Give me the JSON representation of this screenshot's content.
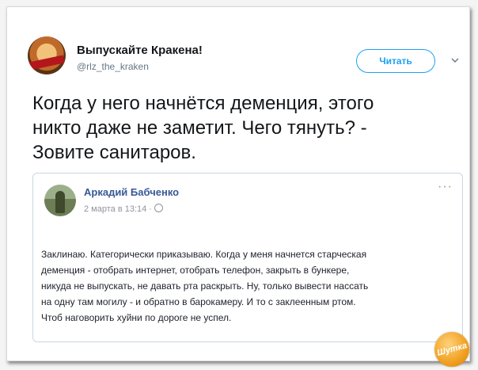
{
  "tweet": {
    "author_name": "Выпускайте Кракена!",
    "author_handle": "@rlz_the_kraken",
    "follow_label": "Читать",
    "text": "Когда у него начнётся деменция, этого\nникто даже не заметит. Чего тянуть? -\nЗовите санитаров."
  },
  "embedded_post": {
    "author_name": "Аркадий Бабченко",
    "date": "2 марта в 13:14 ·",
    "more_icon": "···",
    "text": "Заклинаю. Категорически приказываю. Когда у меня начнется старческая\nдеменция - отобрать интернет, отобрать телефон, закрыть в бункере,\nникуда не выпускать, не давать рта раскрыть. Ну, только вывести нассать\nна одну там могилу - и обратно в барокамеру. И то с заклеенным ртом.\nЧтоб наговорить хуйни по дороге не успел."
  },
  "watermark": {
    "label": "Шутка"
  },
  "colors": {
    "twitter_blue": "#1da1f2",
    "facebook_link": "#385898",
    "watermark": "#f0a020"
  },
  "icons": [
    "avatar",
    "chevron-down-icon",
    "globe-icon",
    "more-options-icon",
    "watermark-logo"
  ]
}
